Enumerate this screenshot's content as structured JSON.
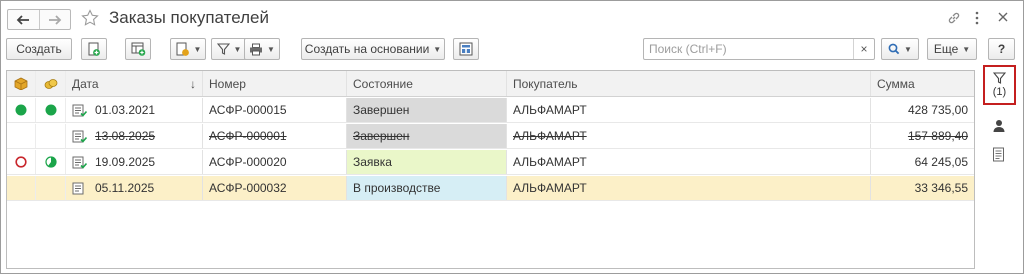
{
  "window": {
    "title": "Заказы покупателей"
  },
  "toolbar": {
    "create_label": "Создать",
    "create_based_label": "Создать на основании",
    "more_label": "Еще",
    "help_label": "?",
    "search_placeholder": "Поиск (Ctrl+F)",
    "search_value": "",
    "clear_symbol": "×"
  },
  "table": {
    "columns": {
      "date": "Дата",
      "number": "Номер",
      "state": "Состояние",
      "customer": "Покупатель",
      "sum": "Сумма"
    },
    "sort_indicator": "↓",
    "rows": [
      {
        "date": "01.03.2021",
        "number": "АСФР-000015",
        "state": "Завершен",
        "customer": "АЛЬФАМАРТ",
        "sum": "428 735,00"
      },
      {
        "date": "13.08.2025",
        "number": "АСФР-000001",
        "state": "Завершен",
        "customer": "АЛЬФАМАРТ",
        "sum": "157 889,40"
      },
      {
        "date": "19.09.2025",
        "number": "АСФР-000020",
        "state": "Заявка",
        "customer": "АЛЬФАМАРТ",
        "sum": "64 245,05"
      },
      {
        "date": "05.11.2025",
        "number": "АСФР-000032",
        "state": "В производстве",
        "customer": "АЛЬФАМАРТ",
        "sum": "33 346,55"
      }
    ]
  },
  "sidebar": {
    "filter_count": "(1)"
  },
  "colors": {
    "status_green": "#1ba54a",
    "status_red": "#c8262c",
    "highlight_border": "#c41f1f",
    "selected_row": "#fcf0c8"
  }
}
